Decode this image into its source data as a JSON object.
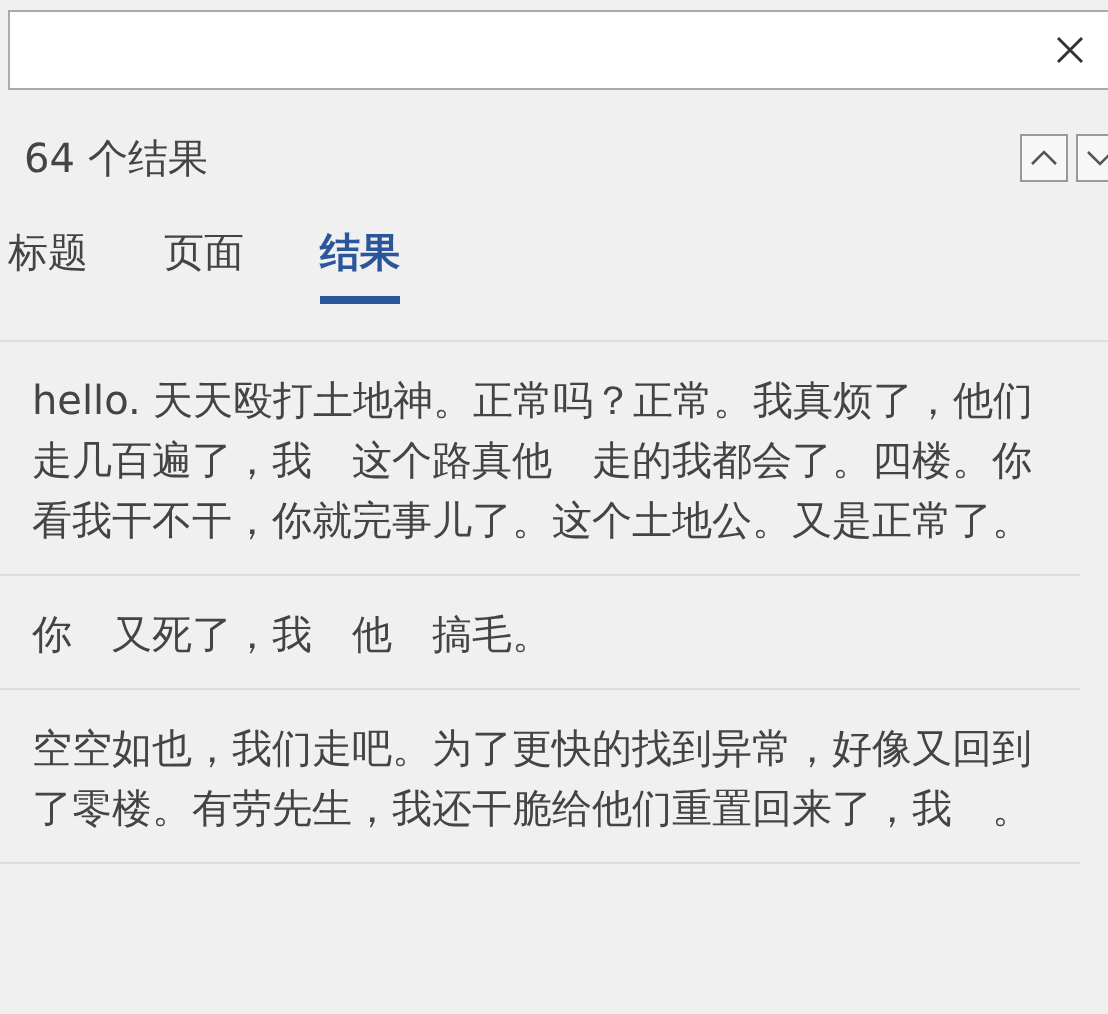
{
  "result_count": "64 个结果",
  "tabs": [
    {
      "label": "标题",
      "selected": false
    },
    {
      "label": "页面",
      "selected": false
    },
    {
      "label": "结果",
      "selected": true
    }
  ],
  "results": [
    "hello. 天天殴打土地神。正常吗？正常。我真烦了，他们走几百遍了，我　这个路真他　走的我都会了。四楼。你看我干不干，你就完事儿了。这个土地公。又是正常了。",
    "你　又死了，我　他　搞毛。",
    "空空如也，我们走吧。为了更快的找到异常，好像又回到了零楼。有劳先生，我还干脆给他们重置回来了，我　。"
  ]
}
